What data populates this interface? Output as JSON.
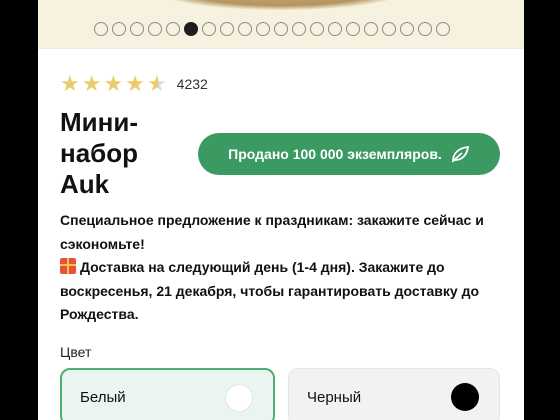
{
  "carousel": {
    "total": 20,
    "active_index": 5
  },
  "rating": {
    "stars": 4.5,
    "max": 5,
    "count": "4232"
  },
  "product": {
    "title": "Мини-набор Auk"
  },
  "badge": {
    "sold_label": "Продано 100 000 экземпляров.",
    "icon": "leaf-icon"
  },
  "promo": {
    "line1": "Специальное предложение к праздникам: закажите сейчас и сэкономьте!",
    "line2": "Доставка на следующий день (1-4 дня). Закажите до воскресенья, 21 декабря, чтобы гарантировать доставку до Рождества."
  },
  "color_selector": {
    "label": "Цвет",
    "options": [
      {
        "name": "Белый",
        "swatch": "#ffffff",
        "selected": true
      },
      {
        "name": "Черный",
        "swatch": "#000000",
        "selected": false
      }
    ]
  },
  "colors": {
    "accent": "#3a9a62",
    "star": "#ebcb6e",
    "hero_bg": "#f7f1df"
  }
}
